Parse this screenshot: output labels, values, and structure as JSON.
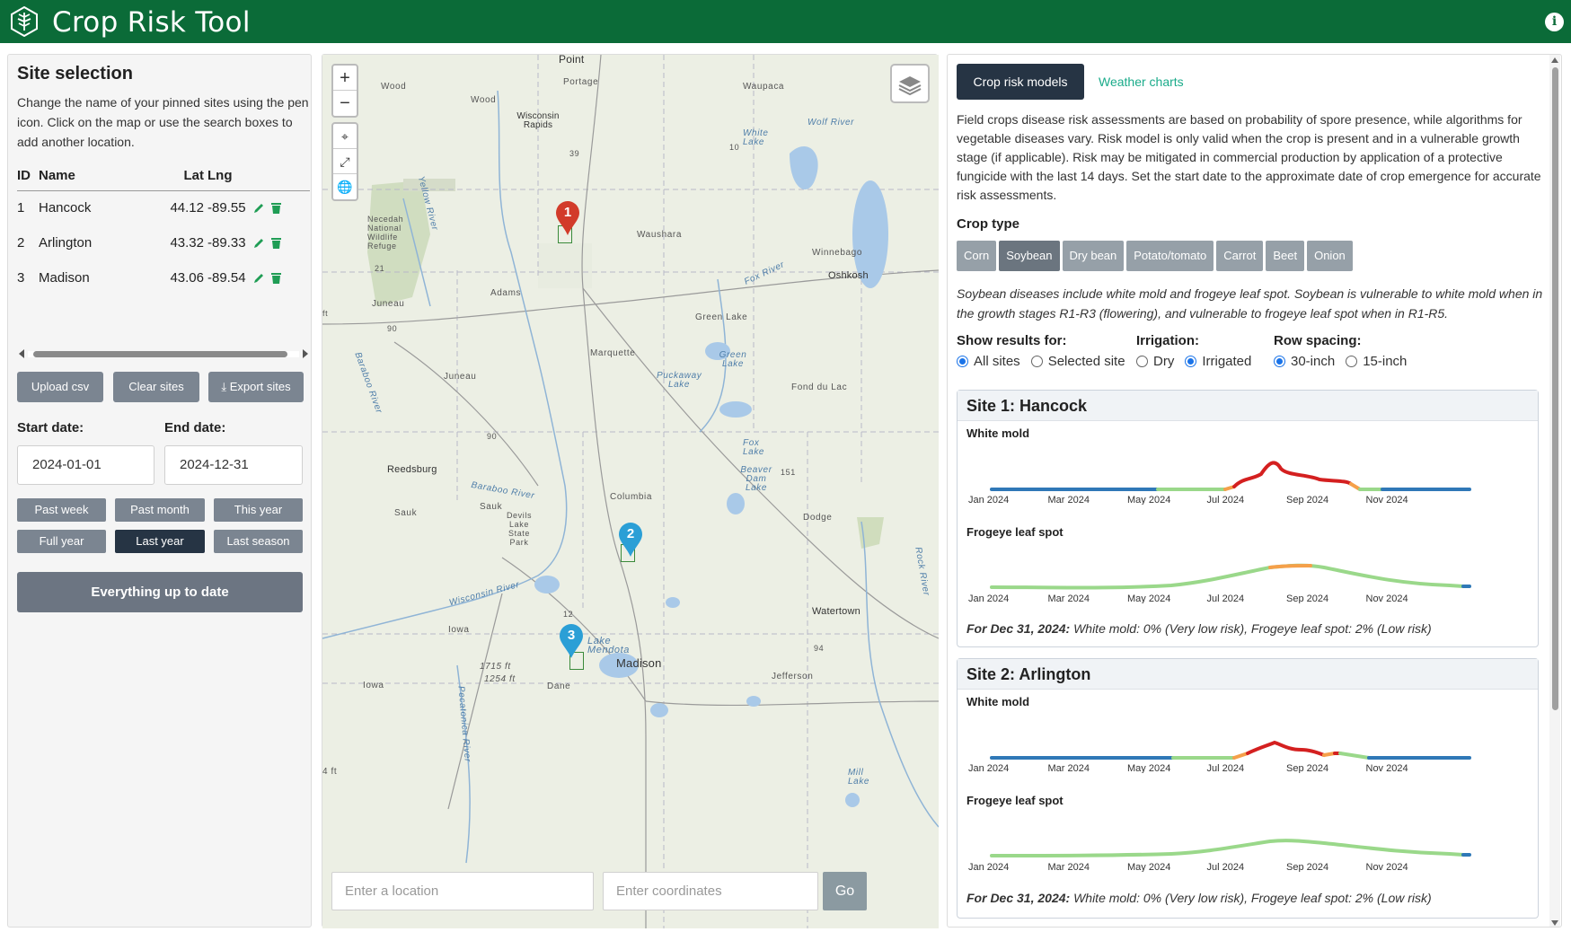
{
  "app": {
    "title": "Crop Risk Tool"
  },
  "left": {
    "heading": "Site selection",
    "intro": "Change the name of your pinned sites using the pen icon. Click on the map or use the search boxes to add another location.",
    "columns": [
      "ID",
      "Name",
      "Lat",
      "Lng"
    ],
    "sites": [
      {
        "id": "1",
        "name": "Hancock",
        "lat": "44.12",
        "lng": "-89.55"
      },
      {
        "id": "2",
        "name": "Arlington",
        "lat": "43.32",
        "lng": "-89.33"
      },
      {
        "id": "3",
        "name": "Madison",
        "lat": "43.06",
        "lng": "-89.54"
      }
    ],
    "buttons": {
      "upload": "Upload csv",
      "clear": "Clear sites",
      "export": "Export sites"
    },
    "start_label": "Start date:",
    "end_label": "End date:",
    "start_value": "2024-01-01",
    "end_value": "2024-12-31",
    "presets": [
      "Past week",
      "Past month",
      "This year",
      "Full year",
      "Last year",
      "Last season"
    ],
    "active_preset": "Last year",
    "status_button": "Everything up to date"
  },
  "map": {
    "labels": {
      "point": "Point",
      "portage": "Portage",
      "waupaca": "Waupaca",
      "wood1": "Wood",
      "wood2": "Wood",
      "wisconsin_rapids": "Wisconsin Rapids",
      "white_lake": "White Lake",
      "wolf_river": "Wolf River",
      "necedah": "Necedah National Wildlife Refuge",
      "yellow_river": "Yellow River",
      "waushara": "Waushara",
      "winnebago": "Winnebago",
      "oshkosh": "Oshkosh",
      "adams": "Adams",
      "fox_river": "Fox River",
      "juneau1": "Juneau",
      "juneau2": "Juneau",
      "green_lake": "Green Lake",
      "green_lake_water": "Green Lake",
      "marquette": "Marquette",
      "puckaway": "Puckaway Lake",
      "fond_du_lac": "Fond du Lac",
      "baraboo_river1": "Baraboo River",
      "reedsburg": "Reedsburg",
      "baraboo_river2": "Baraboo River",
      "fox_lake": "Fox Lake",
      "beaver_dam": "Beaver Dam Lake",
      "columbia": "Columbia",
      "sauk1": "Sauk",
      "sauk2": "Sauk",
      "devils_lake": "Devils Lake State Park",
      "dodge": "Dodge",
      "rock_river": "Rock River",
      "wisconsin_river": "Wisconsin River",
      "watertown": "Watertown",
      "iowa1": "Iowa",
      "lake_mendota": "Lake Mendota",
      "madison": "Madison",
      "h1715": "1715 ft",
      "h1254": "1254 ft",
      "dane": "Dane",
      "jefferson": "Jefferson",
      "iowa2": "Iowa",
      "pecatonica": "Pecatonica River",
      "h4": "4 ft",
      "mill": "Mill Lake",
      "r21": "21",
      "r90a": "90",
      "r90b": "90",
      "r39": "39",
      "r12": "12",
      "r94": "94",
      "r151": "151",
      "r10": "10",
      "ft": "ft"
    },
    "pins": [
      "1",
      "2",
      "3"
    ],
    "location_placeholder": "Enter a location",
    "coords_placeholder": "Enter coordinates",
    "go_label": "Go"
  },
  "right": {
    "tabs": {
      "active": "Crop risk models",
      "other": "Weather charts"
    },
    "description": "Field crops disease risk assessments are based on probability of spore presence, while algorithms for vegetable diseases vary. Risk model is only valid when the crop is present and in a vulnerable growth stage (if applicable). Risk may be mitigated in commercial production by application of a protective fungicide with the last 14 days. Set the start date to the approximate date of crop emergence for accurate risk assessments.",
    "crop_type_label": "Crop type",
    "crops": [
      "Corn",
      "Soybean",
      "Dry bean",
      "Potato/tomato",
      "Carrot",
      "Beet",
      "Onion"
    ],
    "selected_crop": "Soybean",
    "crop_note": "Soybean diseases include white mold and frogeye leaf spot. Soybean is vulnerable to white mold when in the growth stages R1-R3 (flowering), and vulnerable to frogeye leaf spot when in R1-R5.",
    "show_results": {
      "label": "Show results for:",
      "options": [
        "All sites",
        "Selected site"
      ],
      "selected": "All sites"
    },
    "irrigation": {
      "label": "Irrigation:",
      "options": [
        "Dry",
        "Irrigated"
      ],
      "selected": "Irrigated"
    },
    "row_spacing": {
      "label": "Row spacing:",
      "options": [
        "30-inch",
        "15-inch"
      ],
      "selected": "30-inch"
    },
    "site_cards": [
      {
        "title": "Site 1: Hancock",
        "chart1_label": "White mold",
        "chart2_label": "Frogeye leaf spot",
        "summary_date": "For Dec 31, 2024:",
        "summary_text": "White mold: 0% (Very low risk), Frogeye leaf spot: 2% (Low risk)"
      },
      {
        "title": "Site 2: Arlington",
        "chart1_label": "White mold",
        "chart2_label": "Frogeye leaf spot",
        "summary_date": "For Dec 31, 2024:",
        "summary_text": "White mold: 0% (Very low risk), Frogeye leaf spot: 2% (Low risk)"
      }
    ],
    "x_ticks": [
      "Jan 2024",
      "Mar 2024",
      "May 2024",
      "Jul 2024",
      "Sep 2024",
      "Nov 2024"
    ]
  },
  "colors": {
    "header": "#0b6b38",
    "dark_button": "#263444",
    "accent": "#1aab8a",
    "risk_high": "#d42020",
    "risk_med": "#f5a04a",
    "risk_low": "#9ad88a",
    "risk_none": "#2f78b7"
  }
}
